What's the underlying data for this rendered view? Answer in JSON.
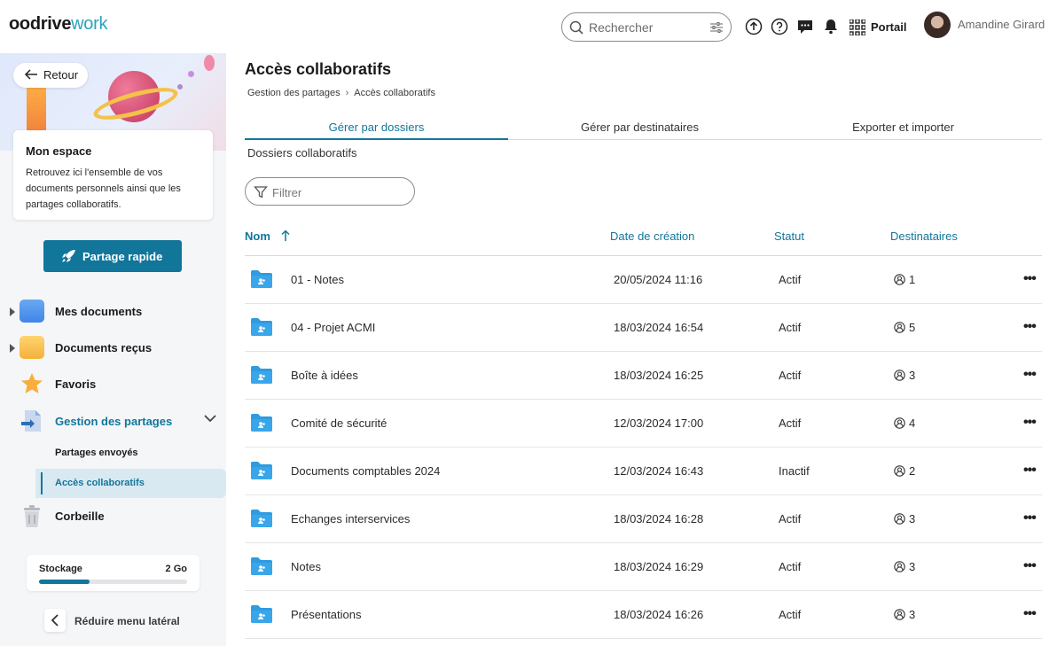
{
  "header": {
    "logo_bold": "oodrive",
    "logo_light": "work",
    "search_placeholder": "Rechercher",
    "portail_label": "Portail",
    "user_name": "Amandine Girard"
  },
  "sidebar": {
    "back_label": "Retour",
    "card_title": "Mon espace",
    "card_text": "Retrouvez ici l'ensemble de vos documents personnels ainsi que les partages collaboratifs.",
    "quick_share_label": "Partage rapide",
    "nav": [
      {
        "label": "Mes documents"
      },
      {
        "label": "Documents reçus"
      },
      {
        "label": "Favoris"
      },
      {
        "label": "Gestion des partages"
      },
      {
        "label": "Corbeille"
      }
    ],
    "subnav": [
      {
        "label": "Partages envoyés"
      },
      {
        "label": "Accès collaboratifs"
      }
    ],
    "storage_label": "Stockage",
    "storage_value": "2 Go",
    "storage_fill_fraction": 0.34,
    "reduce_label": "Réduire menu latéral"
  },
  "main": {
    "title": "Accès collaboratifs",
    "breadcrumb": [
      "Gestion des partages",
      "Accès collaboratifs"
    ],
    "tabs": [
      {
        "label": "Gérer par dossiers"
      },
      {
        "label": "Gérer par destinataires"
      },
      {
        "label": "Exporter et importer"
      }
    ],
    "subheading": "Dossiers collaboratifs",
    "filter_placeholder": "Filtrer",
    "columns": {
      "name": "Nom",
      "date": "Date de création",
      "status": "Statut",
      "recipients": "Destinataires"
    },
    "rows": [
      {
        "name": "01 - Notes",
        "date": "20/05/2024 11:16",
        "status": "Actif",
        "recipients": "1"
      },
      {
        "name": "04 - Projet ACMI",
        "date": "18/03/2024 16:54",
        "status": "Actif",
        "recipients": "5"
      },
      {
        "name": "Boîte à idées",
        "date": "18/03/2024 16:25",
        "status": "Actif",
        "recipients": "3"
      },
      {
        "name": "Comité de sécurité",
        "date": "12/03/2024 17:00",
        "status": "Actif",
        "recipients": "4"
      },
      {
        "name": "Documents comptables 2024",
        "date": "12/03/2024 16:43",
        "status": "Inactif",
        "recipients": "2"
      },
      {
        "name": "Echanges interservices",
        "date": "18/03/2024 16:28",
        "status": "Actif",
        "recipients": "3"
      },
      {
        "name": "Notes",
        "date": "18/03/2024 16:29",
        "status": "Actif",
        "recipients": "3"
      },
      {
        "name": "Présentations",
        "date": "18/03/2024 16:26",
        "status": "Actif",
        "recipients": "3"
      }
    ]
  },
  "colors": {
    "accent": "#12769b",
    "logo_light": "#2aa3b8",
    "sidebar_bg": "#f5f6f8",
    "folder": "#2f9be0"
  }
}
